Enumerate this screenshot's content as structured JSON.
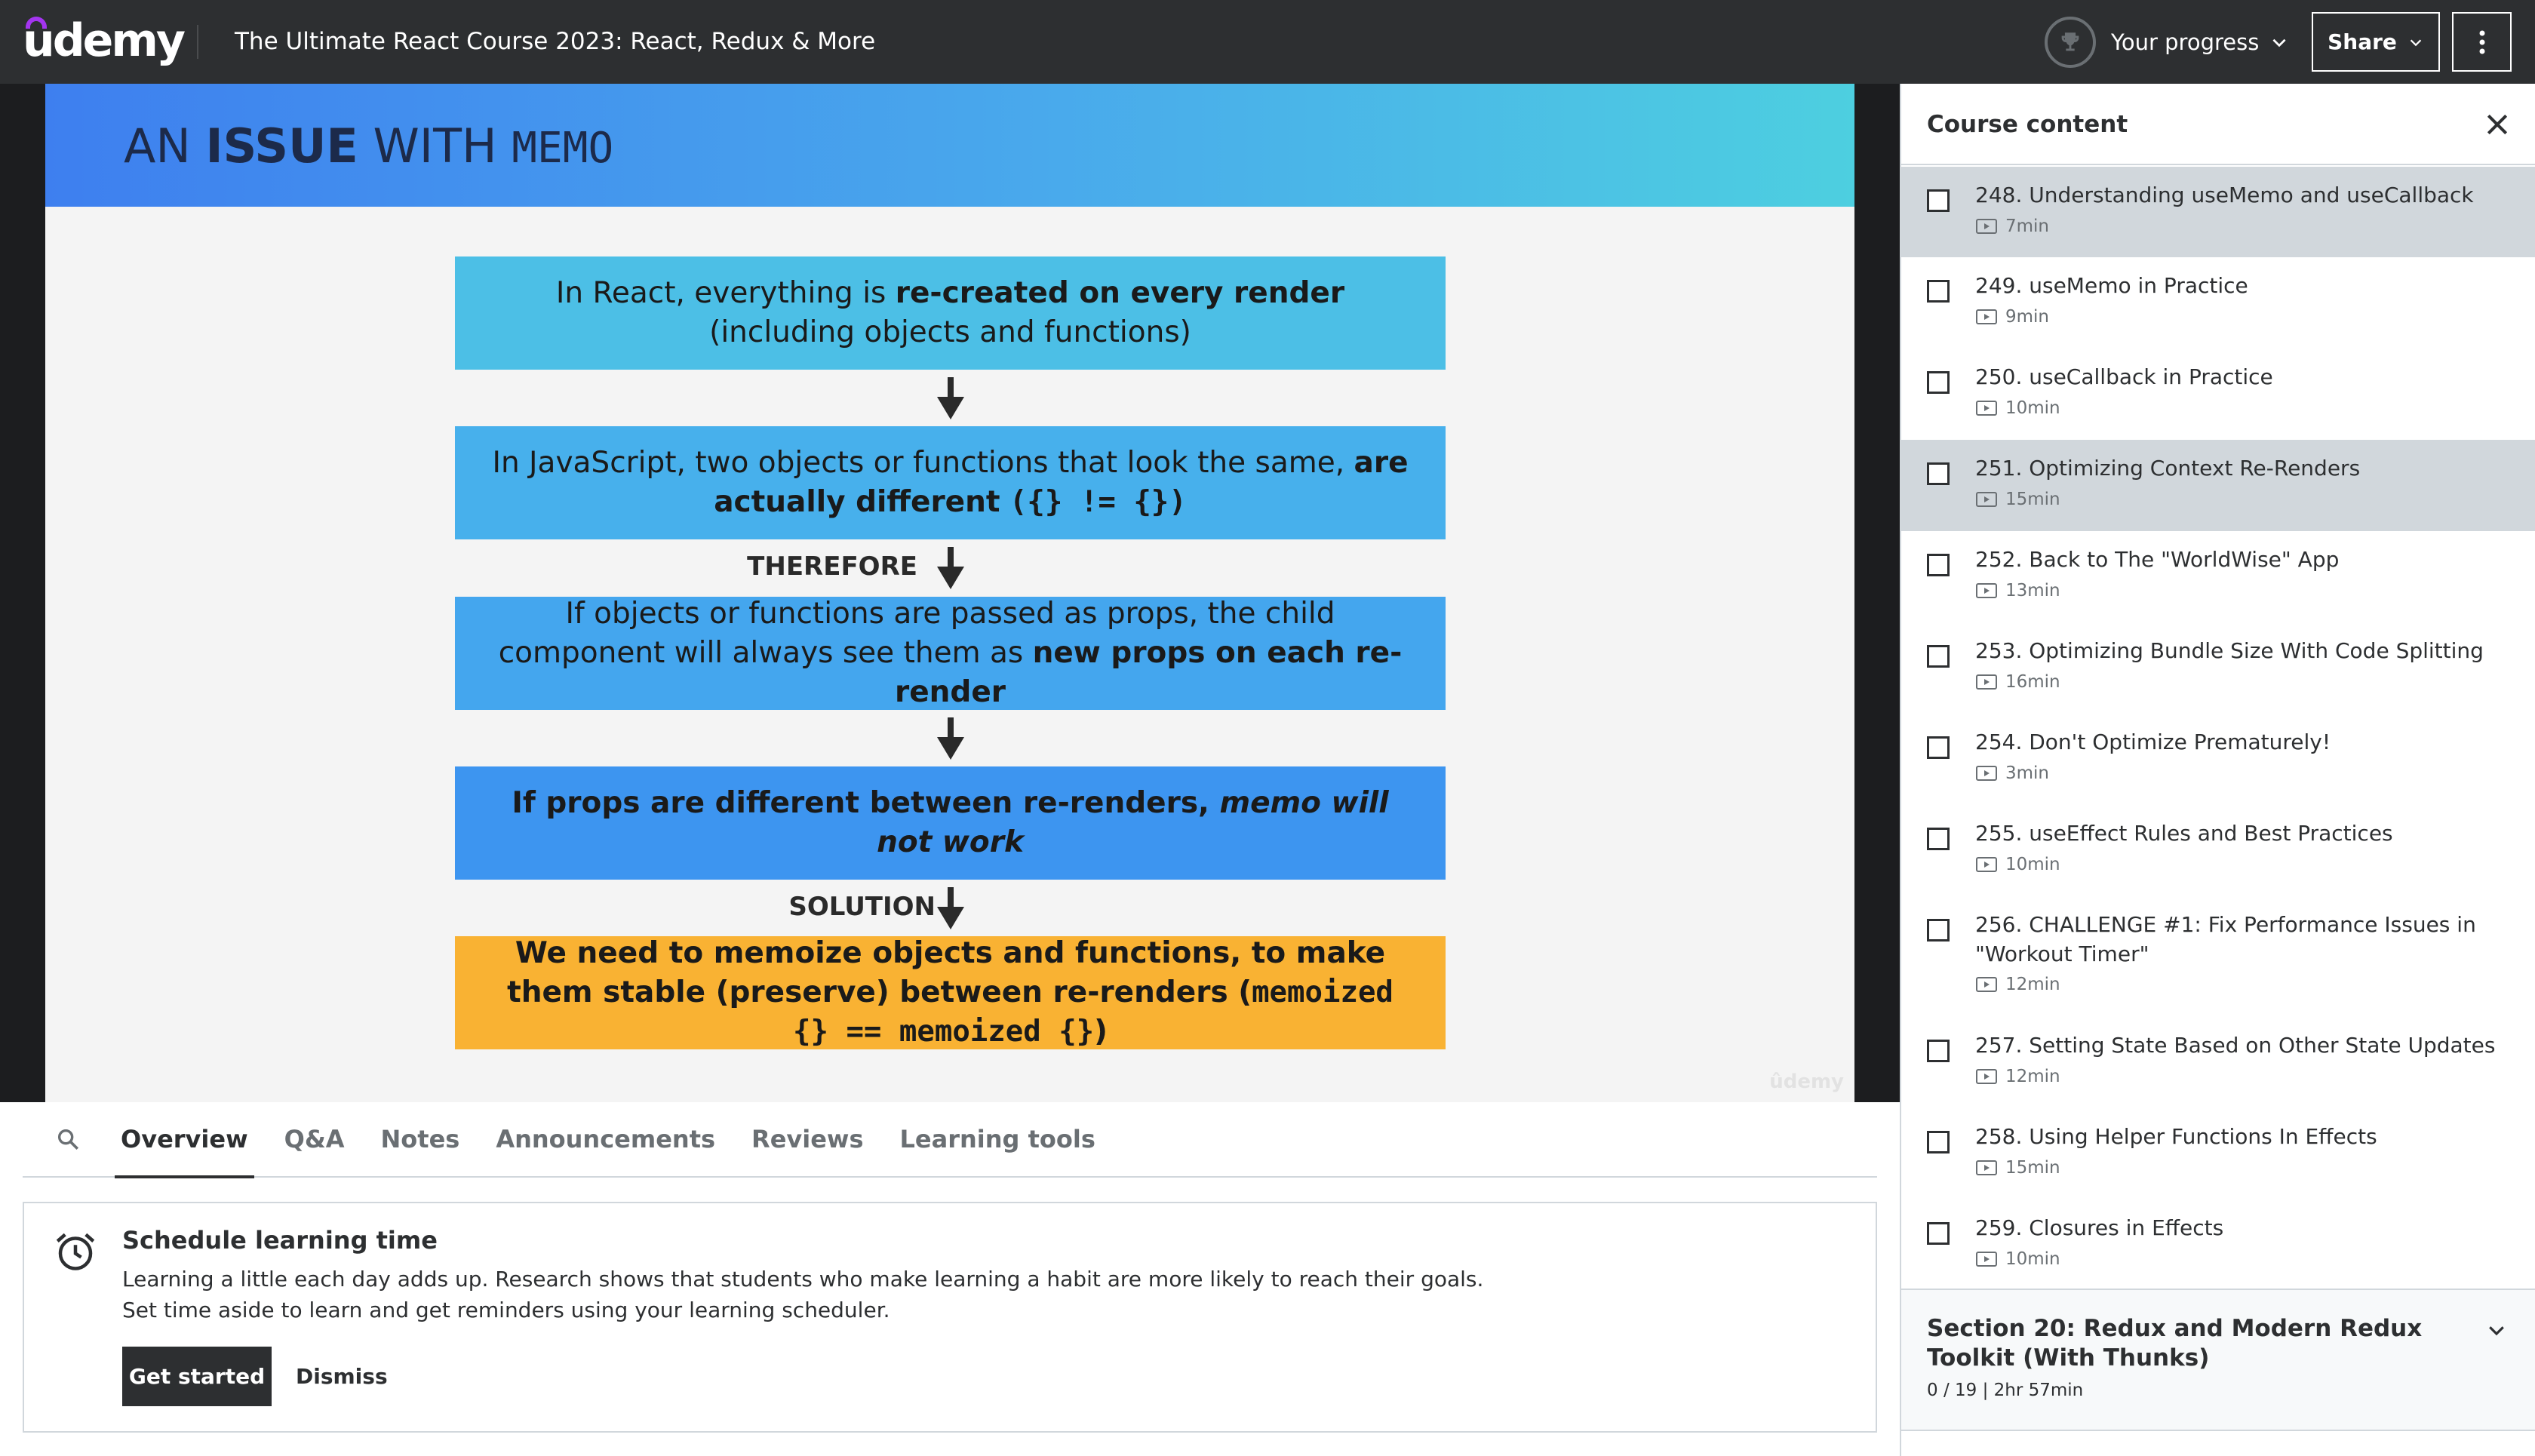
{
  "header": {
    "logo_text": "udemy",
    "course_title": "The Ultimate React Course 2023: React, Redux & More",
    "progress_label": "Your progress",
    "share_label": "Share"
  },
  "slide": {
    "title_pre": "AN ",
    "title_bold": "ISSUE",
    "title_mid": " WITH ",
    "title_mono": "MEMO",
    "box1": {
      "a": "In React, everything is ",
      "b": "re-created on every render",
      "c": " (including objects and functions)"
    },
    "box2": {
      "a": "In JavaScript, two objects or functions that look the same, ",
      "b": "are actually different",
      "c": " ",
      "code": "({} != {})"
    },
    "label_therefore": "THEREFORE",
    "box3": {
      "a": "If objects or functions are passed as props, the child component will always see them as ",
      "b": "new props on each re-render"
    },
    "box4": {
      "a": "If props are different between re-renders, ",
      "b": "memo will not work"
    },
    "label_solution": "SOLUTION",
    "box5": {
      "a": "We need to memoize objects and functions, to make them stable (preserve) between re-renders (",
      "code": "memoized {} == memoized {}",
      "c": ")"
    },
    "watermark": "ûdemy"
  },
  "tabs": {
    "items": [
      "Overview",
      "Q&A",
      "Notes",
      "Announcements",
      "Reviews",
      "Learning tools"
    ],
    "active": "Overview"
  },
  "schedule": {
    "title": "Schedule learning time",
    "desc_line1": "Learning a little each day adds up. Research shows that students who make learning a habit are more likely to reach their goals.",
    "desc_line2": "Set time aside to learn and get reminders using your learning scheduler.",
    "get_started": "Get started",
    "dismiss": "Dismiss"
  },
  "sidebar": {
    "title": "Course content",
    "lectures": [
      {
        "title": "248. Understanding useMemo and useCallback",
        "duration": "7min",
        "highlighted": true
      },
      {
        "title": "249. useMemo in Practice",
        "duration": "9min",
        "highlighted": false
      },
      {
        "title": "250. useCallback in Practice",
        "duration": "10min",
        "highlighted": false
      },
      {
        "title": "251. Optimizing Context Re-Renders",
        "duration": "15min",
        "highlighted": true
      },
      {
        "title": "252. Back to The \"WorldWise\" App",
        "duration": "13min",
        "highlighted": false
      },
      {
        "title": "253. Optimizing Bundle Size With Code Splitting",
        "duration": "16min",
        "highlighted": false
      },
      {
        "title": "254. Don't Optimize Prematurely!",
        "duration": "3min",
        "highlighted": false
      },
      {
        "title": "255. useEffect Rules and Best Practices",
        "duration": "10min",
        "highlighted": false
      },
      {
        "title": "256. CHALLENGE #1: Fix Performance Issues in \"Workout Timer\"",
        "duration": "12min",
        "highlighted": false
      },
      {
        "title": "257. Setting State Based on Other State Updates",
        "duration": "12min",
        "highlighted": false
      },
      {
        "title": "258. Using Helper Functions In Effects",
        "duration": "15min",
        "highlighted": false
      },
      {
        "title": "259. Closures in Effects",
        "duration": "10min",
        "highlighted": false
      }
    ],
    "section": {
      "title": "Section 20: Redux and Modern Redux Toolkit (With Thunks)",
      "meta": "0 / 19 | 2hr 57min"
    }
  },
  "icons": {
    "progress": "trophy-icon",
    "search": "search-icon",
    "alarm": "alarm-clock-icon",
    "close": "close-icon",
    "video": "video-icon"
  }
}
